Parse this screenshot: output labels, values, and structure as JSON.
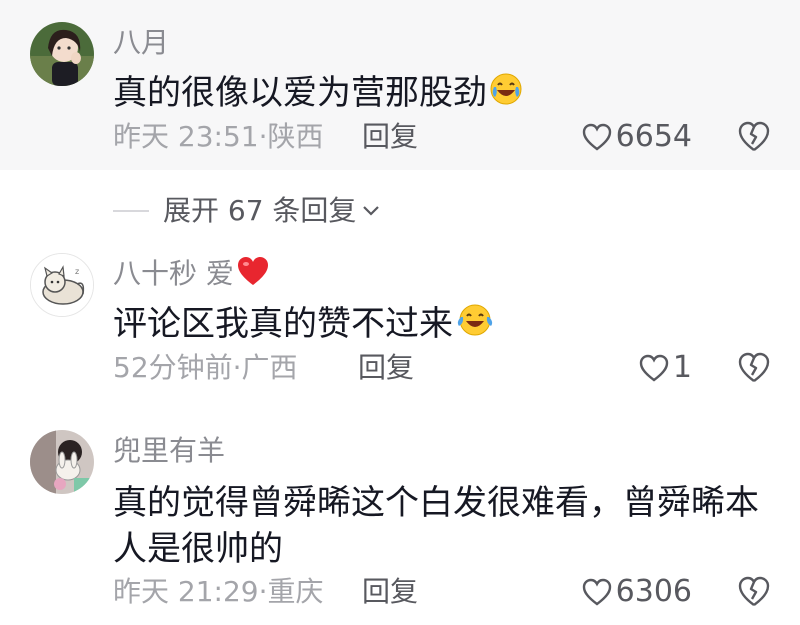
{
  "comments": [
    {
      "username": "八月",
      "text": "真的很像以爱为营那股劲",
      "emoji": "laughing-crying-emoji",
      "time": "昨天 23:51",
      "location": "陕西",
      "reply_label": "回复",
      "likes": "6654"
    },
    {
      "username": "八十秒 爱",
      "badge": "red-heart-emoji",
      "text": "评论区我真的赞不过来",
      "emoji": "laughing-crying-emoji",
      "time": "52分钟前",
      "location": "广西",
      "reply_label": "回复",
      "likes": "1"
    },
    {
      "username": "兜里有羊",
      "text": "真的觉得曾舜晞这个白发很难看，曾舜晞本人是很帅的",
      "time": "昨天 21:29",
      "location": "重庆",
      "reply_label": "回复",
      "likes": "6306"
    }
  ],
  "expand_replies": "展开 67 条回复",
  "colors": {
    "text": "#161823",
    "secondary": "#8a8b91",
    "highlight_bg": "#f7f7f8"
  }
}
